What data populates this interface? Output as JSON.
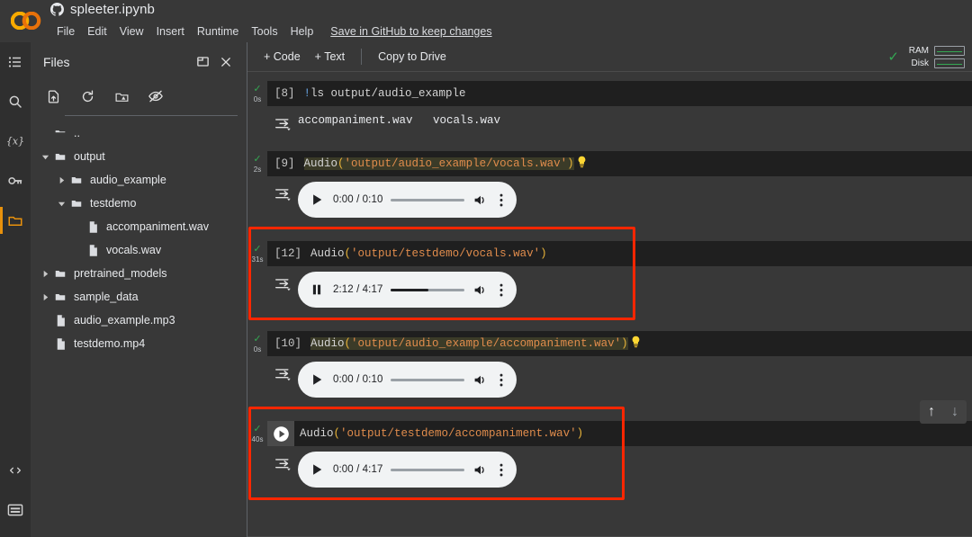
{
  "header": {
    "logo_name": "colab-logo",
    "github_icon": "github-icon",
    "notebook_title": "spleeter.ipynb",
    "menus": [
      "File",
      "Edit",
      "View",
      "Insert",
      "Runtime",
      "Tools",
      "Help"
    ],
    "save_link": "Save in GitHub to keep changes"
  },
  "rail": {
    "items": [
      {
        "name": "table-of-contents-icon",
        "active": false
      },
      {
        "name": "search-icon",
        "active": false
      },
      {
        "name": "variables-icon",
        "active": false
      },
      {
        "name": "secrets-key-icon",
        "active": false
      },
      {
        "name": "files-folder-icon",
        "active": true
      }
    ],
    "bottom_items": [
      {
        "name": "code-snippets-icon"
      },
      {
        "name": "terminal-icon"
      }
    ]
  },
  "files_panel": {
    "title": "Files",
    "head_buttons": [
      {
        "name": "open-in-new-pane-icon"
      },
      {
        "name": "close-panel-icon"
      }
    ],
    "toolbar": [
      {
        "name": "upload-file-icon"
      },
      {
        "name": "refresh-icon"
      },
      {
        "name": "mount-drive-icon"
      },
      {
        "name": "hide-hidden-files-icon"
      }
    ],
    "tree": [
      {
        "label": "..",
        "type": "folder-up",
        "indent": 0,
        "caret": "none"
      },
      {
        "label": "output",
        "type": "folder",
        "indent": 0,
        "caret": "down"
      },
      {
        "label": "audio_example",
        "type": "folder",
        "indent": 1,
        "caret": "right"
      },
      {
        "label": "testdemo",
        "type": "folder",
        "indent": 1,
        "caret": "down"
      },
      {
        "label": "accompaniment.wav",
        "type": "file",
        "indent": 2,
        "caret": "none"
      },
      {
        "label": "vocals.wav",
        "type": "file",
        "indent": 2,
        "caret": "none"
      },
      {
        "label": "pretrained_models",
        "type": "folder",
        "indent": 0,
        "caret": "right"
      },
      {
        "label": "sample_data",
        "type": "folder",
        "indent": 0,
        "caret": "right"
      },
      {
        "label": "audio_example.mp3",
        "type": "file",
        "indent": 0,
        "caret": "none"
      },
      {
        "label": "testdemo.mp4",
        "type": "file",
        "indent": 0,
        "caret": "none"
      }
    ]
  },
  "notebook_toolbar": {
    "add_code": "+ Code",
    "add_text": "+ Text",
    "copy_to_drive": "Copy to Drive",
    "status_check": "✓",
    "meters": [
      {
        "label": "RAM"
      },
      {
        "label": "Disk"
      }
    ]
  },
  "cells": [
    {
      "exec_count": "[8]",
      "exec_time": "0s",
      "code_kind": "shell",
      "code_prefix": "!",
      "code_text": "ls output/audio_example",
      "highlighted": false,
      "bulb": false,
      "output_kind": "text",
      "output_text": "accompaniment.wav   vocals.wav"
    },
    {
      "exec_count": "[9]",
      "exec_time": "2s",
      "code_kind": "audio",
      "code_fn": "Audio",
      "code_path": "'output/audio_example/vocals.wav'",
      "highlighted": false,
      "bulb": true,
      "output_kind": "player",
      "player": {
        "state": "paused",
        "current_time": "0:00",
        "duration": "0:10",
        "time_label": "0:00 / 0:10",
        "progress_pct": 0
      }
    },
    {
      "exec_count": "[12]",
      "exec_time": "31s",
      "code_kind": "audio",
      "code_fn": "Audio",
      "code_path": "'output/testdemo/vocals.wav'",
      "highlighted": true,
      "bulb": false,
      "output_kind": "player",
      "player": {
        "state": "playing",
        "current_time": "2:12",
        "duration": "4:17",
        "time_label": "2:12 / 4:17",
        "progress_pct": 51
      }
    },
    {
      "exec_count": "[10]",
      "exec_time": "0s",
      "code_kind": "audio",
      "code_fn": "Audio",
      "code_path": "'output/audio_example/accompaniment.wav'",
      "highlighted": false,
      "bulb": true,
      "output_kind": "player",
      "player": {
        "state": "paused",
        "current_time": "0:00",
        "duration": "0:10",
        "time_label": "0:00 / 0:10",
        "progress_pct": 0
      }
    },
    {
      "exec_count": "",
      "exec_time": "40s",
      "code_kind": "audio",
      "code_fn": "Audio",
      "code_path": "'output/testdemo/accompaniment.wav'",
      "highlighted": true,
      "run_button": true,
      "bulb": false,
      "output_kind": "player",
      "player": {
        "state": "paused",
        "current_time": "0:00",
        "duration": "4:17",
        "time_label": "0:00 / 4:17",
        "progress_pct": 0
      }
    }
  ],
  "nav_arrows": [
    {
      "name": "move-cell-up-icon",
      "glyph": "↑"
    },
    {
      "name": "move-cell-down-icon",
      "glyph": "↓"
    }
  ],
  "colors": {
    "page_bg": "#383838",
    "code_bg": "#1f1f1f",
    "accent_orange": "#e8910c",
    "highlight_red": "#ff2600",
    "status_green": "#34a853",
    "string_orange": "#e08c4c",
    "paren_yellow": "#e8b339"
  }
}
